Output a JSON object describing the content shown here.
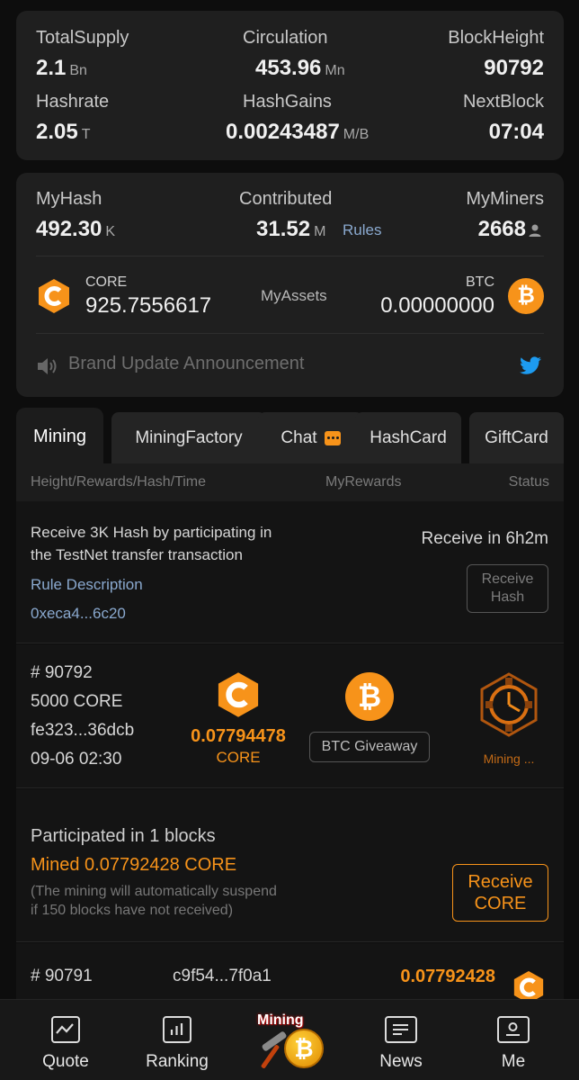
{
  "network_stats": {
    "total_supply": {
      "label": "TotalSupply",
      "value": "2.1",
      "unit": "Bn"
    },
    "circulation": {
      "label": "Circulation",
      "value": "453.96",
      "unit": "Mn"
    },
    "block_height": {
      "label": "BlockHeight",
      "value": "90792"
    },
    "hashrate": {
      "label": "Hashrate",
      "value": "2.05",
      "unit": "T"
    },
    "hash_gains": {
      "label": "HashGains",
      "value": "0.00243487",
      "unit": "M/B"
    },
    "next_block": {
      "label": "NextBlock",
      "value": "07:04"
    }
  },
  "my_stats": {
    "my_hash": {
      "label": "MyHash",
      "value": "492.30",
      "unit": "K"
    },
    "contributed": {
      "label": "Contributed",
      "value": "31.52",
      "unit": "M",
      "rules_link": "Rules"
    },
    "my_miners": {
      "label": "MyMiners",
      "value": "2668"
    },
    "assets": {
      "core_label": "CORE",
      "core_value": "925.7556617",
      "title": "MyAssets",
      "btc_label": "BTC",
      "btc_value": "0.00000000"
    },
    "announcement": "Brand Update Announcement"
  },
  "tabs": [
    {
      "label": "Mining"
    },
    {
      "label": "MiningFactory"
    },
    {
      "label": "Chat"
    },
    {
      "label": "HashCard"
    },
    {
      "label": "GiftCard"
    }
  ],
  "table_headers": {
    "col1": "Height/Rewards/Hash/Time",
    "col2": "MyRewards",
    "col3": "Status"
  },
  "testnet_promo": {
    "text_line1": "Receive 3K Hash by participating in",
    "text_line2": "the TestNet transfer transaction",
    "rule_link": "Rule Description",
    "address": "0xeca4...6c20",
    "countdown": "Receive in 6h2m",
    "button_line1": "Receive",
    "button_line2": "Hash"
  },
  "block_current": {
    "height": "# 90792",
    "reward": "5000 CORE",
    "hash": "fe323...36dcb",
    "time": "09-06 02:30",
    "my_reward_value": "0.07794478",
    "my_reward_unit": "CORE",
    "btc_giveaway": "BTC Giveaway",
    "status": "Mining ..."
  },
  "summary": {
    "participated": "Participated in 1 blocks",
    "mined": "Mined 0.07792428 CORE",
    "note_line1": "(The mining will automatically suspend",
    "note_line2": "if 150 blocks have not received)",
    "button_line1": "Receive",
    "button_line2": "CORE"
  },
  "block_previous": {
    "height": "# 90791",
    "hash": "c9f54...7f0a1",
    "my_reward_value": "0.07792428"
  },
  "bottom_nav": {
    "quote": "Quote",
    "ranking": "Ranking",
    "mining_badge": "Mining",
    "news": "News",
    "me": "Me"
  },
  "colors": {
    "accent_orange": "#f7931a",
    "link_blue": "#8aa9cf",
    "twitter_blue": "#1d9bf0",
    "card_bg": "#1f1f1f",
    "page_bg": "#0d0d0d"
  },
  "icons": {
    "core": "core-hexagon-icon",
    "btc": "bitcoin-icon",
    "speaker": "speaker-icon",
    "twitter": "twitter-icon",
    "chat": "chat-bubble-icon",
    "person": "person-icon",
    "mining_status": "gear-clock-icon"
  }
}
